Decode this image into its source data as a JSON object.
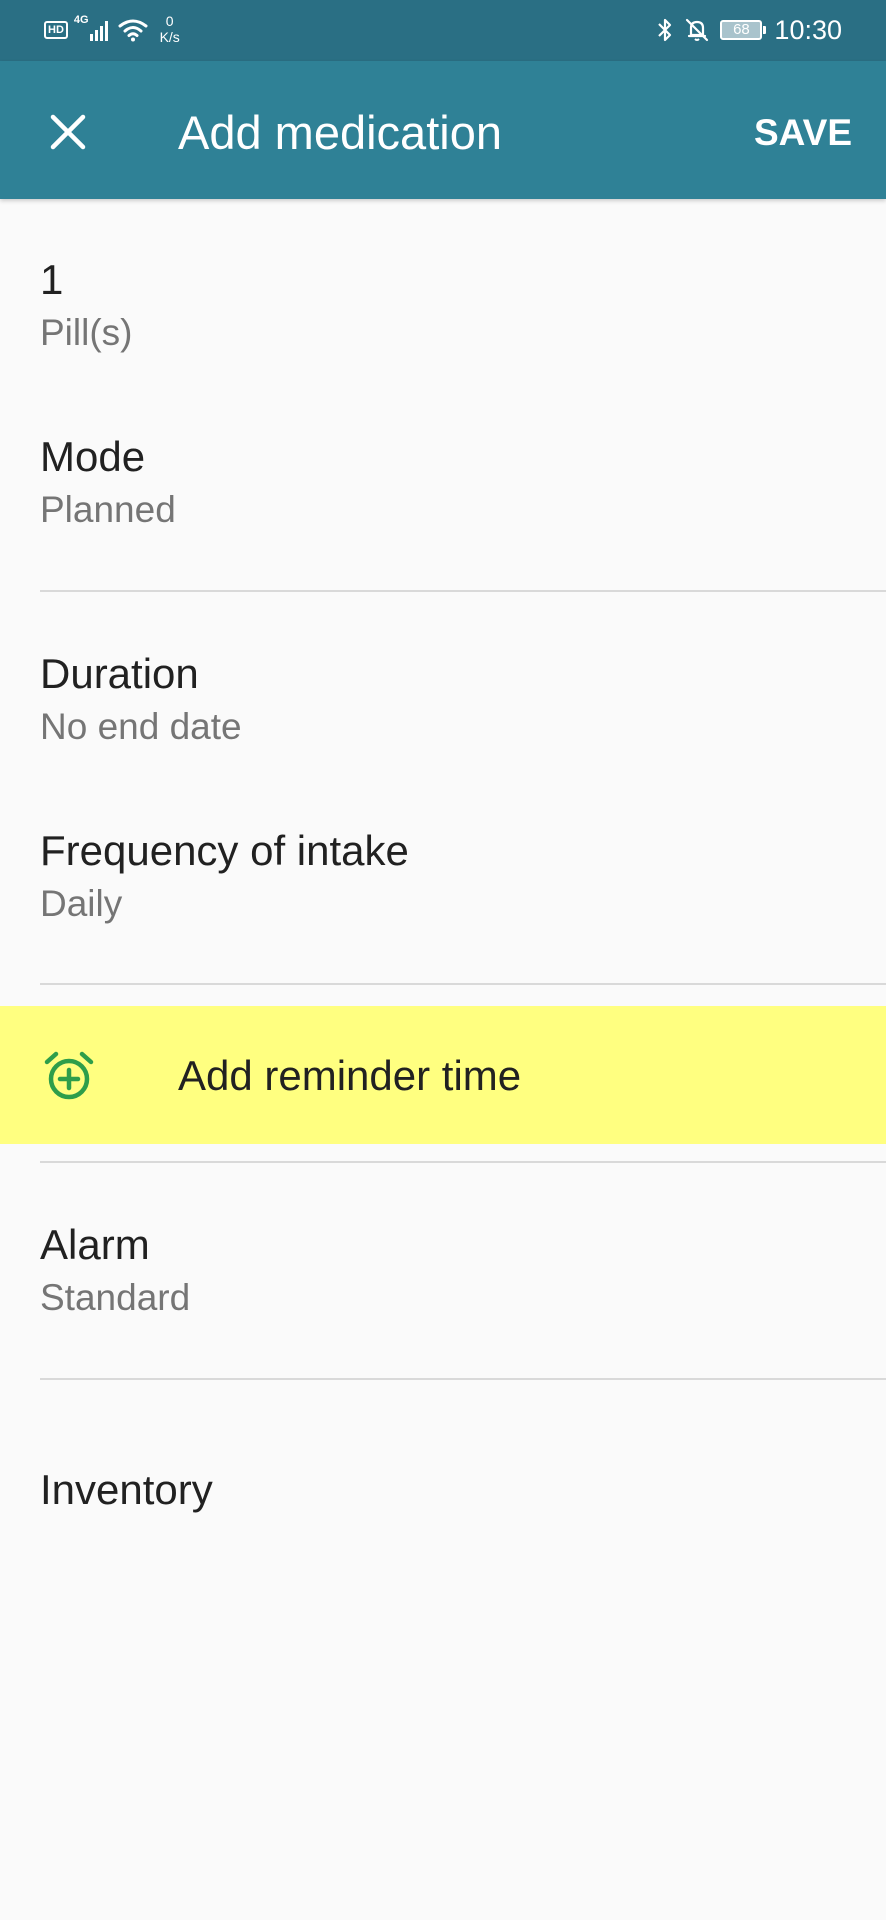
{
  "status_bar": {
    "hd": "HD",
    "network": "4G",
    "speed_value": "0",
    "speed_unit": "K/s",
    "battery": "68",
    "time": "10:30"
  },
  "app_bar": {
    "title": "Add medication",
    "save_label": "SAVE"
  },
  "form": {
    "dose": {
      "value": "1",
      "unit": "Pill(s)"
    },
    "mode": {
      "label": "Mode",
      "value": "Planned"
    },
    "duration": {
      "label": "Duration",
      "value": "No end date"
    },
    "frequency": {
      "label": "Frequency of intake",
      "value": "Daily"
    },
    "reminder": {
      "label": "Add reminder time"
    },
    "alarm": {
      "label": "Alarm",
      "value": "Standard"
    },
    "inventory": {
      "label": "Inventory"
    }
  },
  "colors": {
    "status_bar": "#2a6f84",
    "app_bar": "#2f8196",
    "highlight": "#ffff80",
    "icon_green": "#2e9e4a"
  }
}
